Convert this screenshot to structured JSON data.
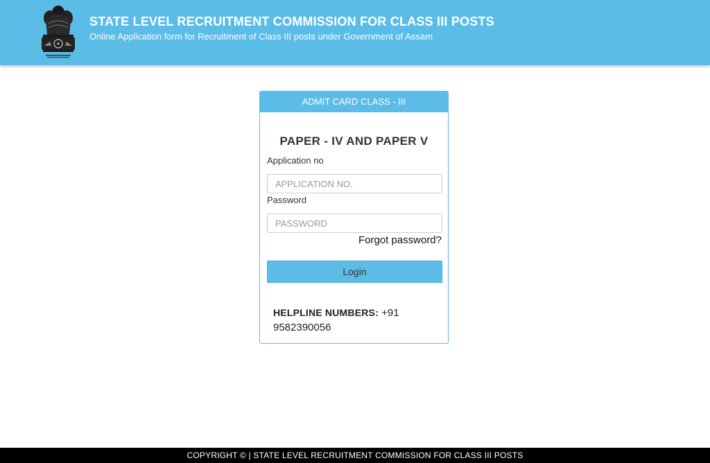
{
  "header": {
    "title": "STATE LEVEL RECRUITMENT COMMISSION FOR CLASS III POSTS",
    "subtitle": "Online Application form for Recruitment of Class III posts under Government of Assam",
    "emblem_icon": "national-emblem-icon"
  },
  "card": {
    "header": "ADMIT CARD CLASS - III",
    "paper_title": "PAPER - IV AND PAPER V",
    "application_label": "Application no",
    "application_placeholder": "APPLICATION NO.",
    "application_value": "",
    "password_label": "Password",
    "password_placeholder": "PASSWORD",
    "password_value": "",
    "forgot_password": "Forgot password?",
    "login_label": "Login",
    "helpline_label": "HELPLINE NUMBERS:",
    "helpline_number": "+91 9582390056"
  },
  "footer": {
    "text": "COPYRIGHT © | STATE LEVEL RECRUITMENT COMMISSION FOR CLASS III POSTS"
  },
  "colors": {
    "brand": "#5bbce8",
    "footer_bg": "#000000"
  }
}
